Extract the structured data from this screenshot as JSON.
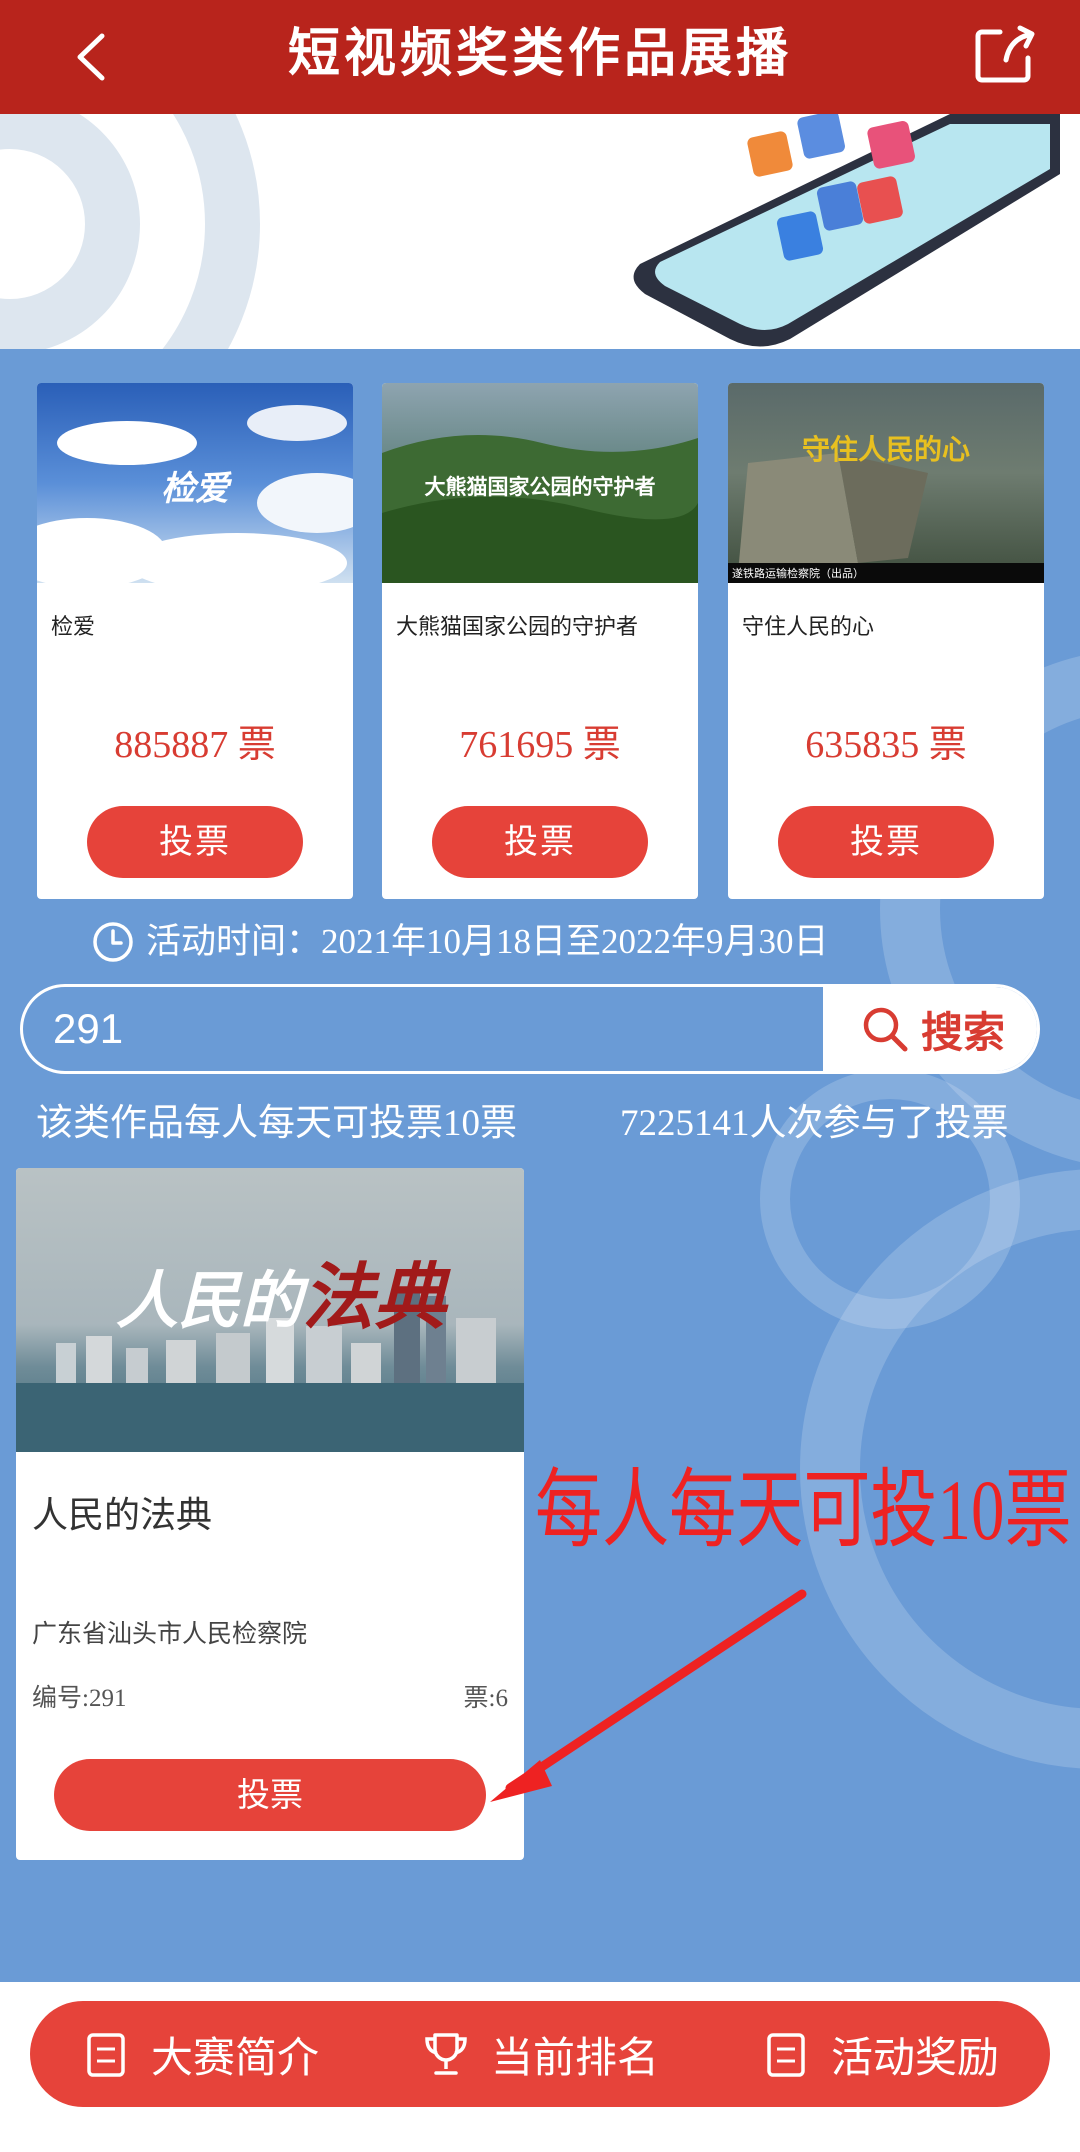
{
  "header": {
    "title": "短视频奖类作品展播",
    "back_icon": "chevron-left-icon",
    "share_icon": "share-icon"
  },
  "top_works": [
    {
      "name": "检爱",
      "thumb_caption": "检爱",
      "votes": "885887 票",
      "vote_label": "投票"
    },
    {
      "name": "大熊猫国家公园的守护者",
      "thumb_caption": "大熊猫国家公园的守护者",
      "votes": "761695 票",
      "vote_label": "投票"
    },
    {
      "name": "守住人民的心",
      "thumb_caption": "守住人民的心",
      "thumb_footer": "遂铁路运输检察院（出品）",
      "votes": "635835 票",
      "vote_label": "投票"
    }
  ],
  "activity_period": "活动时间：2021年10月18日至2022年9月30日",
  "search": {
    "value": "291",
    "button_label": "搜索"
  },
  "rules_text": "该类作品每人每天可投票10票",
  "participation_text": "7225141人次参与了投票",
  "result": {
    "thumb_title_a": "人民的",
    "thumb_title_b": "法典",
    "title": "人民的法典",
    "org": "广东省汕头市人民检察院",
    "number": "编号:291",
    "votes": "票:6",
    "vote_label": "投票"
  },
  "annotation": "每人每天可投10票",
  "bottom_tabs": [
    {
      "label": "大赛简介",
      "icon": "document-icon"
    },
    {
      "label": "当前排名",
      "icon": "trophy-icon"
    },
    {
      "label": "活动奖励",
      "icon": "document-icon"
    }
  ],
  "colors": {
    "header": "#b8241c",
    "accent": "#e6433a",
    "background": "#6a9bd6"
  }
}
